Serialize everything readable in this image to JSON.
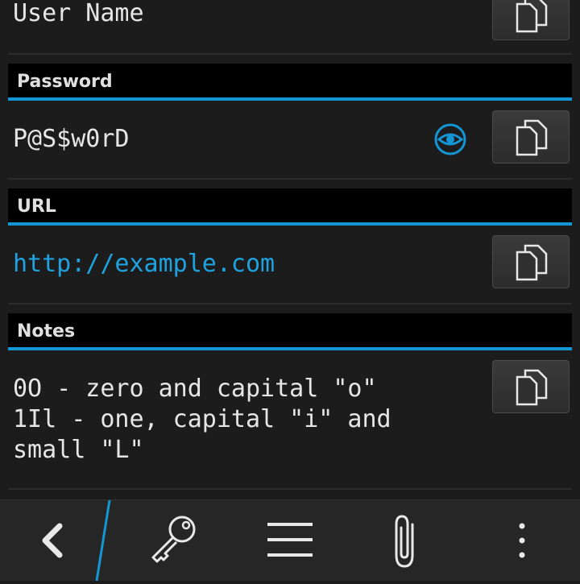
{
  "fields": {
    "username": {
      "label": "User Name"
    },
    "password": {
      "header": "Password",
      "value": "P@S$w0rD"
    },
    "url": {
      "header": "URL",
      "value": "http://example.com"
    },
    "notes": {
      "header": "Notes",
      "lines": [
        "0O - zero and capital \"o\"",
        "1Il - one, capital \"i\" and",
        "small \"L\""
      ]
    }
  },
  "icons": {
    "copy": "copy-icon",
    "eye": "eye-icon",
    "back": "back-icon",
    "key": "key-icon",
    "menu": "menu-icon",
    "attach": "paperclip-icon",
    "overflow": "overflow-icon"
  },
  "colors": {
    "accent": "#1596d4",
    "link": "#1fa2e0",
    "background": "#1c1c1c"
  }
}
